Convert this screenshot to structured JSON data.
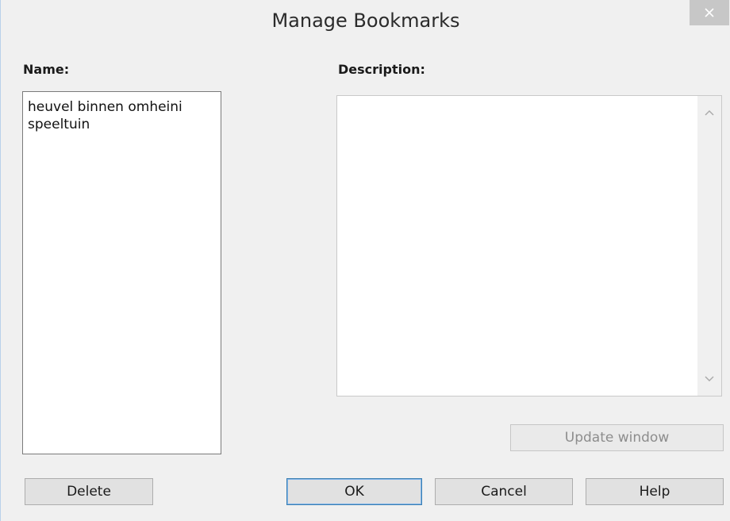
{
  "window": {
    "title": "Manage Bookmarks",
    "close_icon": "close-icon"
  },
  "labels": {
    "name": "Name:",
    "description": "Description:"
  },
  "bookmarks": [
    "heuvel binnen omheini",
    "speeltuin"
  ],
  "description": {
    "value": ""
  },
  "buttons": {
    "update": "Update window",
    "delete": "Delete",
    "ok": "OK",
    "cancel": "Cancel",
    "help": "Help"
  },
  "colors": {
    "background": "#f0f0f0",
    "default_button_border": "#3c7fb1",
    "disabled_text": "#8d8d8d"
  }
}
